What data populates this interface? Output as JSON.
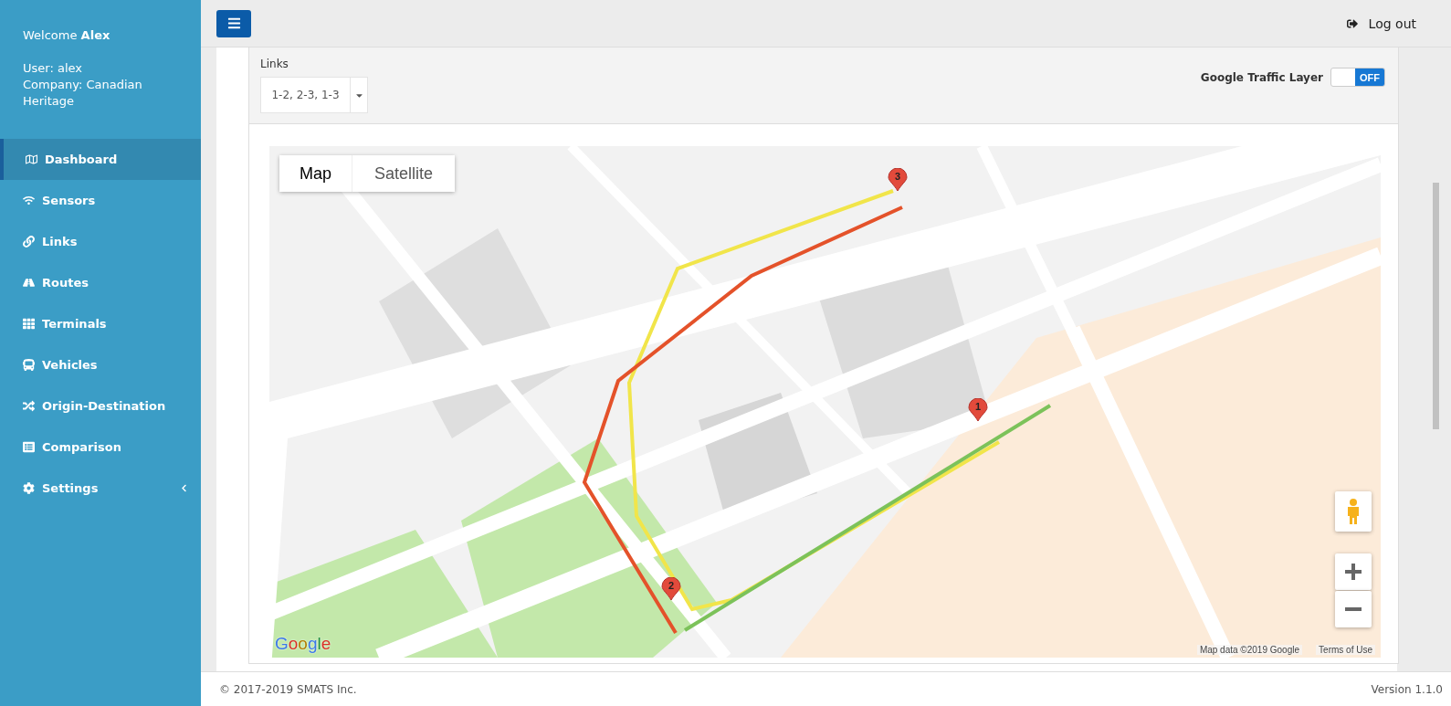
{
  "sidebar": {
    "welcome": "Welcome **Alex**",
    "user": "User: alex",
    "company": "Company: Canadian Heritage",
    "items": [
      {
        "label": "Dashboard",
        "selected": true,
        "kind": "link"
      },
      {
        "label": "Sensors",
        "selected": false,
        "kind": "link"
      },
      {
        "label": "Links",
        "selected": false,
        "kind": "link"
      },
      {
        "label": "Routes",
        "selected": false,
        "kind": "link"
      },
      {
        "label": "Terminals",
        "selected": false,
        "kind": "link"
      },
      {
        "label": "Vehicles",
        "selected": false,
        "kind": "link"
      },
      {
        "label": "Origin-Destination",
        "selected": false,
        "kind": "link"
      },
      {
        "label": "Comparison",
        "selected": false,
        "kind": "link"
      },
      {
        "label": "Settings",
        "selected": false,
        "kind": "group"
      }
    ]
  },
  "topbar": {
    "logout": "Log out"
  },
  "filters": {
    "links_label": "Links",
    "links_value": "1-2, 2-3, 1-3",
    "traffic_layer": {
      "label": "Google Traffic Layer",
      "on": false,
      "state_text": "OFF"
    }
  },
  "map": {
    "type_buttons": [
      {
        "label": "Map",
        "selected": true
      },
      {
        "label": "Satellite",
        "selected": false
      }
    ],
    "markers": [
      {
        "label": "3"
      },
      {
        "label": "1"
      },
      {
        "label": "2"
      }
    ],
    "logo": "Google",
    "attribution": "Map data ©2019 Google",
    "terms": "Terms of Use"
  },
  "footer": {
    "copyright": "© 2017-2019 SMATS Inc.",
    "version": "Version 1.1.0"
  }
}
